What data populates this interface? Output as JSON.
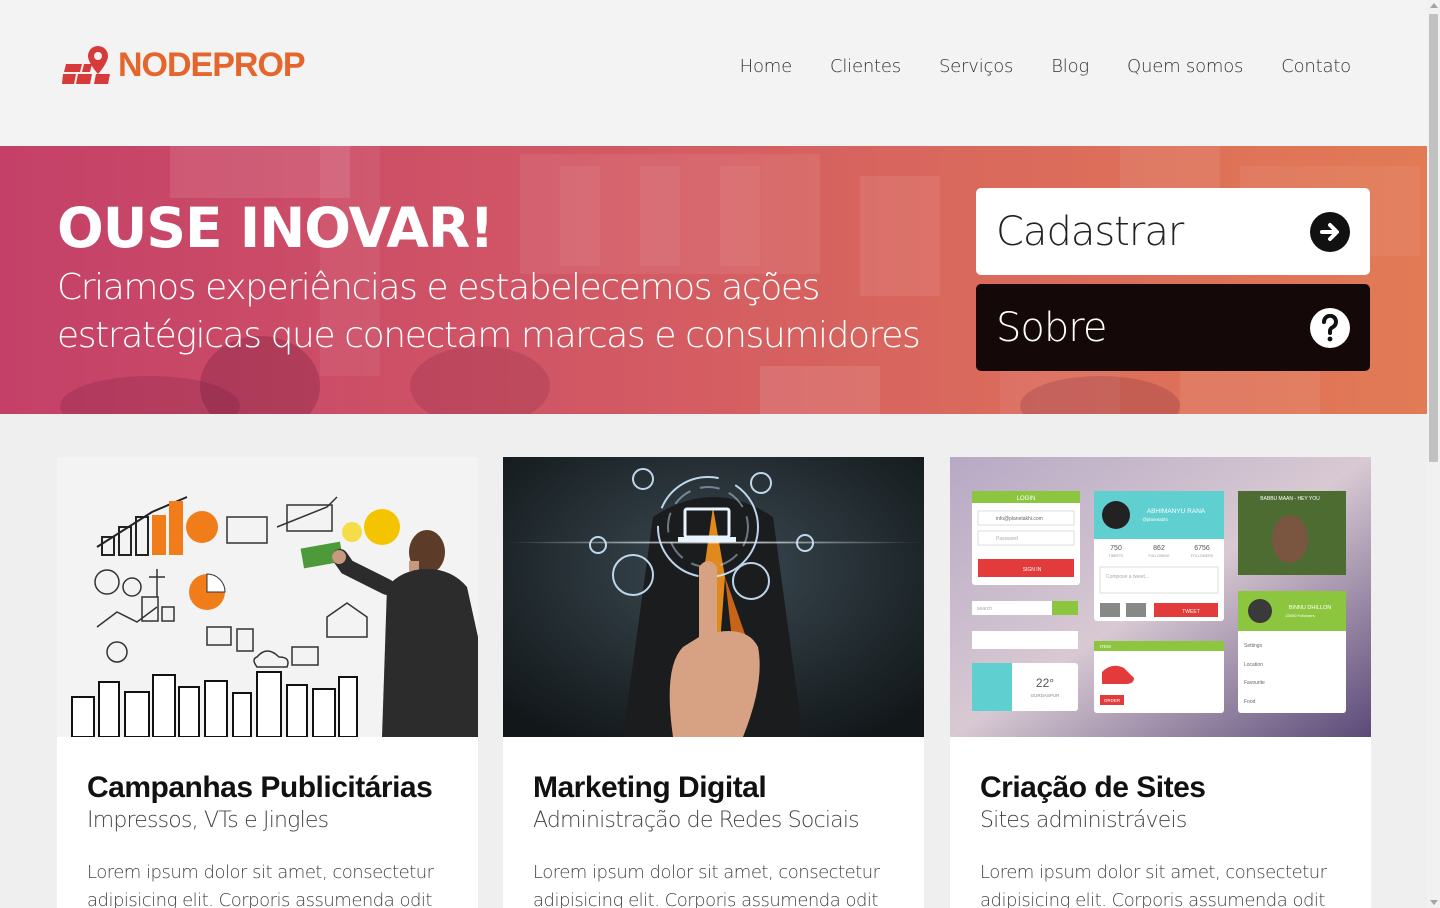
{
  "brand": {
    "name": "NODEPROP",
    "color": "#e4662d",
    "mark_color": "#d63a3a"
  },
  "nav": {
    "items": [
      {
        "label": "Home"
      },
      {
        "label": "Clientes"
      },
      {
        "label": "Serviços"
      },
      {
        "label": "Blog"
      },
      {
        "label": "Quem somos"
      },
      {
        "label": "Contato"
      }
    ]
  },
  "hero": {
    "title": "OUSE INOVAR!",
    "subtitle": "Criamos experiências e estabelecemos ações estratégicas que conectam marcas e consumidores",
    "primary_cta": {
      "label": "Cadastrar",
      "icon": "arrow-right-circle-icon"
    },
    "secondary_cta": {
      "label": "Sobre",
      "icon": "question-circle-icon"
    },
    "gradient": [
      "#c44068",
      "#e27a55"
    ]
  },
  "cards": [
    {
      "title": "Campanhas Publicitárias",
      "subtitle": "Impressos, VTs e Jingles",
      "body": "Lorem ipsum dolor sit amet, consectetur adipisicing elit. Corporis assumenda odit",
      "image": "business-sketch-image"
    },
    {
      "title": "Marketing Digital",
      "subtitle": "Administração de Redes Sociais",
      "body": "Lorem ipsum dolor sit amet, consectetur adipisicing elit. Corporis assumenda odit",
      "image": "digital-touch-image"
    },
    {
      "title": "Criação de Sites",
      "subtitle": "Sites administráveis",
      "body": "Lorem ipsum dolor sit amet, consectetur adipisicing elit. Corporis assumenda odit",
      "image": "ui-kit-image",
      "ui_kit_text": {
        "login": "LOGIN",
        "email": "info@planetakhi.com",
        "password": "Password",
        "sign_in": "SIGN IN",
        "search": "search",
        "profile_name": "ABHIMANYU RANA",
        "profile_handle": "@planetabhi",
        "stats": [
          "750",
          "862",
          "6756"
        ],
        "stat_labels": [
          "TWEETS",
          "FOLLOWING",
          "FOLLOWERS"
        ],
        "compose": "Compose a tweet...",
        "tweet": "TWEET",
        "video_title": "BABBU MAAN - HEY YOU",
        "user2": "BINNU DHILLON",
        "user2_sub": "23000 Followers",
        "menu": [
          "Settings",
          "Location",
          "Favourite",
          "Food"
        ],
        "item": "ITEM",
        "order": "ORDER",
        "temp": "22°",
        "city": "GURDASPUR"
      }
    }
  ]
}
